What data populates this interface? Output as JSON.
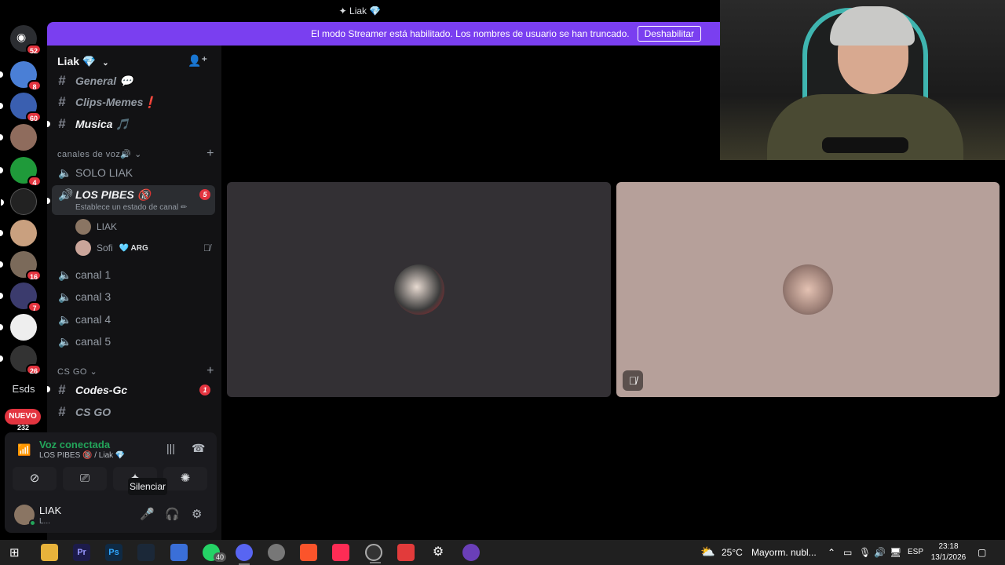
{
  "title": {
    "text": "Liak",
    "gem": "💎"
  },
  "banner": {
    "text": "El modo Streamer está habilitado. Los nombres de usuario se han truncado.",
    "button": "Deshabilitar"
  },
  "servers": [
    {
      "name": "discord-home",
      "badge": "52",
      "color": "#2b2d31"
    },
    {
      "name": "server-2",
      "badge": "8",
      "color": "#4a7fd6"
    },
    {
      "name": "server-corp",
      "badge": "60",
      "color": "#3a5fb0"
    },
    {
      "name": "server-4",
      "badge": "",
      "color": "#8f6c5d"
    },
    {
      "name": "server-stumble",
      "badge": "4",
      "color": "#1f9a3a"
    },
    {
      "name": "server-6",
      "badge": "",
      "color": "#222"
    },
    {
      "name": "server-7",
      "badge": "",
      "color": "#c9a07f"
    },
    {
      "name": "server-8",
      "badge": "16",
      "color": "#7b6a5a"
    },
    {
      "name": "server-9",
      "badge": "7",
      "color": "#3b3b6d"
    },
    {
      "name": "server-10",
      "badge": "",
      "color": "#eee"
    },
    {
      "name": "server-11",
      "badge": "26",
      "color": "#333"
    }
  ],
  "rail_text": {
    "esds": "Esds",
    "nuevo": "NUEVO",
    "nuevo_count": "232"
  },
  "guild": {
    "name": "Liak 💎"
  },
  "channels_top": [
    {
      "name": "General 💬"
    },
    {
      "name": "Clips-Memes❗"
    },
    {
      "name": "Musica 🎵"
    }
  ],
  "voice_category": "canales de voz🔊",
  "voice_channels": {
    "solo": "SOLO LIAK",
    "active": "LOS PIBES 🔞",
    "active_status": "Establece un estado de canal ✏",
    "active_count": "5",
    "members": [
      {
        "name": "LIAK",
        "tag": ""
      },
      {
        "name": "Sofi",
        "tag": "🩵 ARG"
      }
    ],
    "others": [
      "canal 1",
      "canal 3",
      "canal 4",
      "canal 5"
    ]
  },
  "csgo_category": "CS GO",
  "csgo_channels": [
    {
      "name": "Codes-Gc",
      "badge": "1"
    },
    {
      "name": "CS GO",
      "badge": ""
    }
  ],
  "voice_panel": {
    "status": "Voz conectada",
    "sub": "LOS PIBES 🔞 / Liak 💎",
    "tooltip": "Silenciar"
  },
  "user": {
    "name": "LIAK",
    "sub": "L..."
  },
  "taskbar": {
    "weather_temp": "25°C",
    "weather_desc": "Mayorm. nubl...",
    "lang": "ESP",
    "time": "23:18",
    "date": "13/1/2026",
    "whatsapp_badge": "40"
  }
}
